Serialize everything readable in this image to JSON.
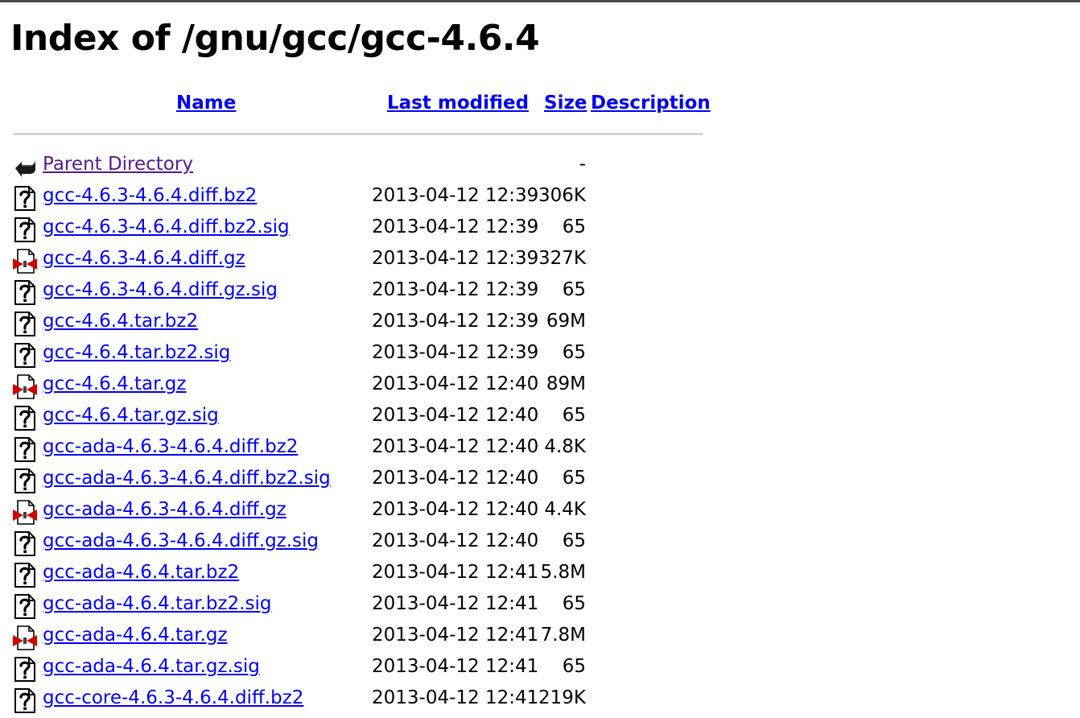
{
  "page": {
    "title": "Index of /gnu/gcc/gcc-4.6.4"
  },
  "columns": {
    "name": "Name",
    "last_modified": "Last modified",
    "size": "Size",
    "description": "Description"
  },
  "parent": {
    "label": "Parent Directory",
    "date": "",
    "size": "-",
    "icon": "back-icon"
  },
  "files": [
    {
      "name": "gcc-4.6.3-4.6.4.diff.bz2",
      "date": "2013-04-12 12:39",
      "size": "306K",
      "icon": "unknown-file-icon"
    },
    {
      "name": "gcc-4.6.3-4.6.4.diff.bz2.sig",
      "date": "2013-04-12 12:39",
      "size": "65",
      "icon": "unknown-file-icon"
    },
    {
      "name": "gcc-4.6.3-4.6.4.diff.gz",
      "date": "2013-04-12 12:39",
      "size": "327K",
      "icon": "compressed-file-icon"
    },
    {
      "name": "gcc-4.6.3-4.6.4.diff.gz.sig",
      "date": "2013-04-12 12:39",
      "size": "65",
      "icon": "unknown-file-icon"
    },
    {
      "name": "gcc-4.6.4.tar.bz2",
      "date": "2013-04-12 12:39",
      "size": "69M",
      "icon": "unknown-file-icon"
    },
    {
      "name": "gcc-4.6.4.tar.bz2.sig",
      "date": "2013-04-12 12:39",
      "size": "65",
      "icon": "unknown-file-icon"
    },
    {
      "name": "gcc-4.6.4.tar.gz",
      "date": "2013-04-12 12:40",
      "size": "89M",
      "icon": "compressed-file-icon"
    },
    {
      "name": "gcc-4.6.4.tar.gz.sig",
      "date": "2013-04-12 12:40",
      "size": "65",
      "icon": "unknown-file-icon"
    },
    {
      "name": "gcc-ada-4.6.3-4.6.4.diff.bz2",
      "date": "2013-04-12 12:40",
      "size": "4.8K",
      "icon": "unknown-file-icon"
    },
    {
      "name": "gcc-ada-4.6.3-4.6.4.diff.bz2.sig",
      "date": "2013-04-12 12:40",
      "size": "65",
      "icon": "unknown-file-icon"
    },
    {
      "name": "gcc-ada-4.6.3-4.6.4.diff.gz",
      "date": "2013-04-12 12:40",
      "size": "4.4K",
      "icon": "compressed-file-icon"
    },
    {
      "name": "gcc-ada-4.6.3-4.6.4.diff.gz.sig",
      "date": "2013-04-12 12:40",
      "size": "65",
      "icon": "unknown-file-icon"
    },
    {
      "name": "gcc-ada-4.6.4.tar.bz2",
      "date": "2013-04-12 12:41",
      "size": "5.8M",
      "icon": "unknown-file-icon"
    },
    {
      "name": "gcc-ada-4.6.4.tar.bz2.sig",
      "date": "2013-04-12 12:41",
      "size": "65",
      "icon": "unknown-file-icon"
    },
    {
      "name": "gcc-ada-4.6.4.tar.gz",
      "date": "2013-04-12 12:41",
      "size": "7.8M",
      "icon": "compressed-file-icon"
    },
    {
      "name": "gcc-ada-4.6.4.tar.gz.sig",
      "date": "2013-04-12 12:41",
      "size": "65",
      "icon": "unknown-file-icon"
    },
    {
      "name": "gcc-core-4.6.3-4.6.4.diff.bz2",
      "date": "2013-04-12 12:41",
      "size": "219K",
      "icon": "unknown-file-icon"
    }
  ],
  "colors": {
    "link": "#0000ee",
    "visited_link": "#551a8b",
    "rule": "#999999",
    "compressed_accent": "#cc0000"
  }
}
